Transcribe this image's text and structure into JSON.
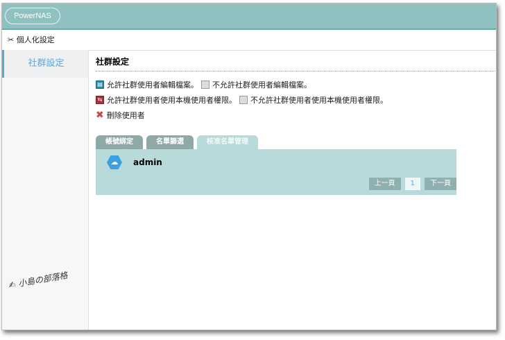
{
  "header": {
    "logo": "PowerNAS"
  },
  "subheader": {
    "title": "個人化設定"
  },
  "sidebar": {
    "items": [
      {
        "label": "社群設定"
      }
    ]
  },
  "main": {
    "title": "社群設定",
    "legend": [
      "允許社群使用者編輯檔案。",
      "不允許社群使用者編輯檔案。",
      "允許社群使用者使用本機使用者權限。",
      "不允許社群使用者使用本機使用者權限。",
      "刪除使用者"
    ],
    "tabs": [
      {
        "label": "帳號綁定"
      },
      {
        "label": "名單篩選"
      },
      {
        "label": "核准名單管理"
      }
    ],
    "users": [
      {
        "name": "admin"
      }
    ],
    "pagination": {
      "prev": "上一頁",
      "current": "1",
      "next": "下一頁"
    }
  },
  "watermark": "小島の部落格"
}
